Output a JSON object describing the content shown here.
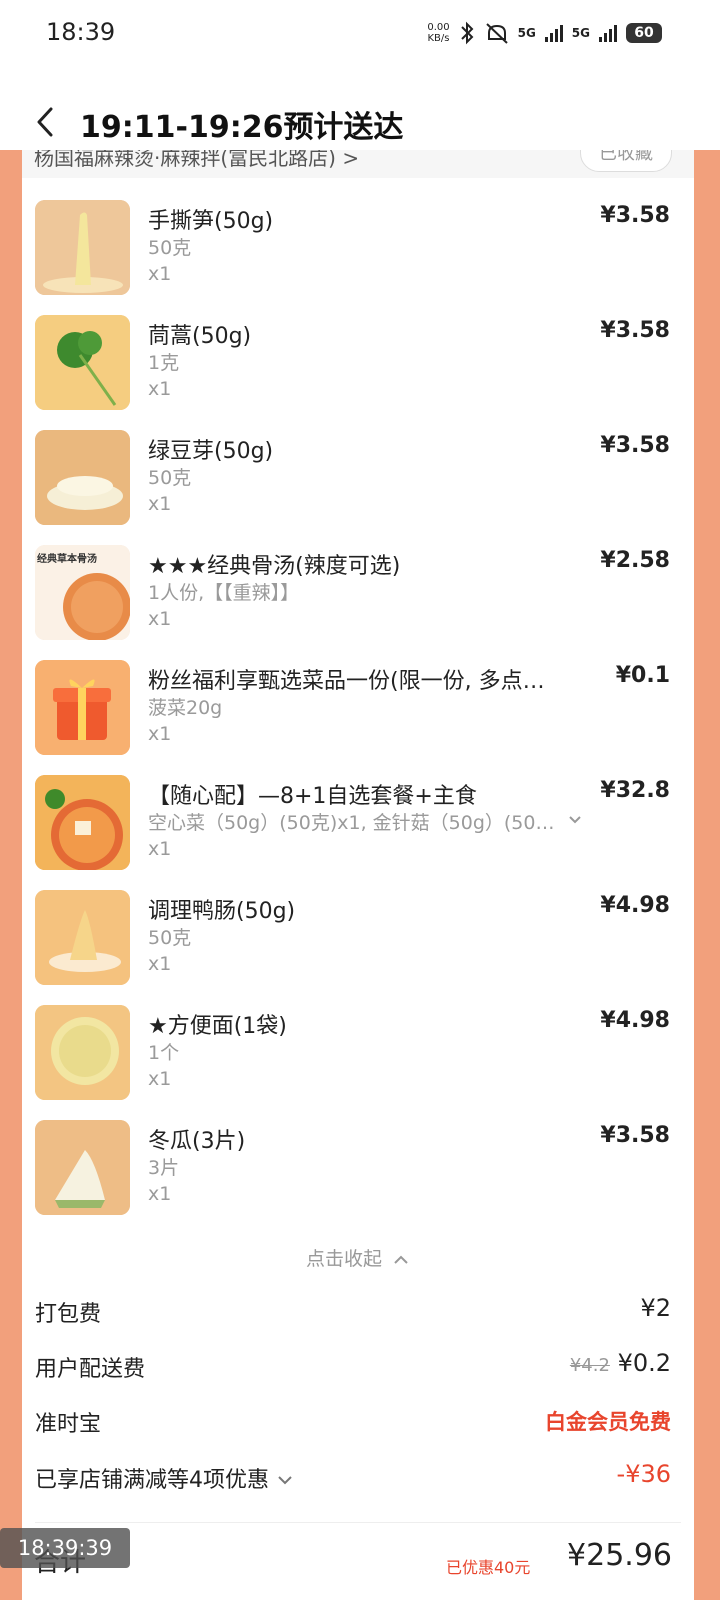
{
  "status_bar": {
    "time": "18:39",
    "net_speed_value": "0.00",
    "net_speed_unit": "KB/s",
    "sim1": "5G",
    "sim2": "5G",
    "battery": "60"
  },
  "header": {
    "eta": "19:11-19:26预计送达"
  },
  "shop": {
    "name": "杨国福麻辣烫·麻辣拌(富民北路店)",
    "fav_label": "已收藏"
  },
  "items": [
    {
      "name": "手撕笋(50g)",
      "spec": "50克",
      "qty": "x1",
      "price": "¥3.58",
      "thumb_color": "#e7b98a"
    },
    {
      "name": "茼蒿(50g)",
      "spec": "1克",
      "qty": "x1",
      "price": "¥3.58",
      "thumb_color": "#f2c57a"
    },
    {
      "name": "绿豆芽(50g)",
      "spec": "50克",
      "qty": "x1",
      "price": "¥3.58",
      "thumb_color": "#e8b47c"
    },
    {
      "name": "★★★经典骨汤(辣度可选)",
      "spec": "1人份,【【重辣】】",
      "qty": "x1",
      "price": "¥2.58",
      "thumb_color": "#f5e6d8"
    },
    {
      "name": "粉丝福利享甄选菜品一份(限一份, 多点…",
      "spec": "菠菜20g",
      "qty": "x1",
      "price": "¥0.1",
      "thumb_color": "#f6a85e"
    },
    {
      "name": "【随心配】—8+1自选套餐+主食",
      "spec": "空心菜（50g）(50克)x1, 金针菇（50g）(50…",
      "qty": "x1",
      "price": "¥32.8",
      "thumb_color": "#e9a24a"
    },
    {
      "name": "调理鸭肠(50g)",
      "spec": "50克",
      "qty": "x1",
      "price": "¥4.98",
      "thumb_color": "#f3c07c"
    },
    {
      "name": "★方便面(1袋)",
      "spec": "1个",
      "qty": "x1",
      "price": "¥4.98",
      "thumb_color": "#f0c27e"
    },
    {
      "name": "冬瓜(3片)",
      "spec": "3片",
      "qty": "x1",
      "price": "¥3.58",
      "thumb_color": "#ebbb84"
    }
  ],
  "collapse_label": "点击收起",
  "fees": {
    "packing": {
      "label": "打包费",
      "value": "¥2"
    },
    "delivery": {
      "label": "用户配送费",
      "original": "¥4.2",
      "value": "¥0.2"
    },
    "ontime": {
      "label": "准时宝",
      "value": "白金会员免费"
    },
    "discounts": {
      "label": "已享店铺满减等4项优惠",
      "value": "-¥36"
    }
  },
  "total": {
    "label": "合计",
    "saved": "已优惠40元",
    "amount": "¥25.96"
  },
  "screenshot_time": "18:39:39",
  "colors": {
    "accent_red": "#e8452d",
    "page_bg": "#f2a07c"
  }
}
